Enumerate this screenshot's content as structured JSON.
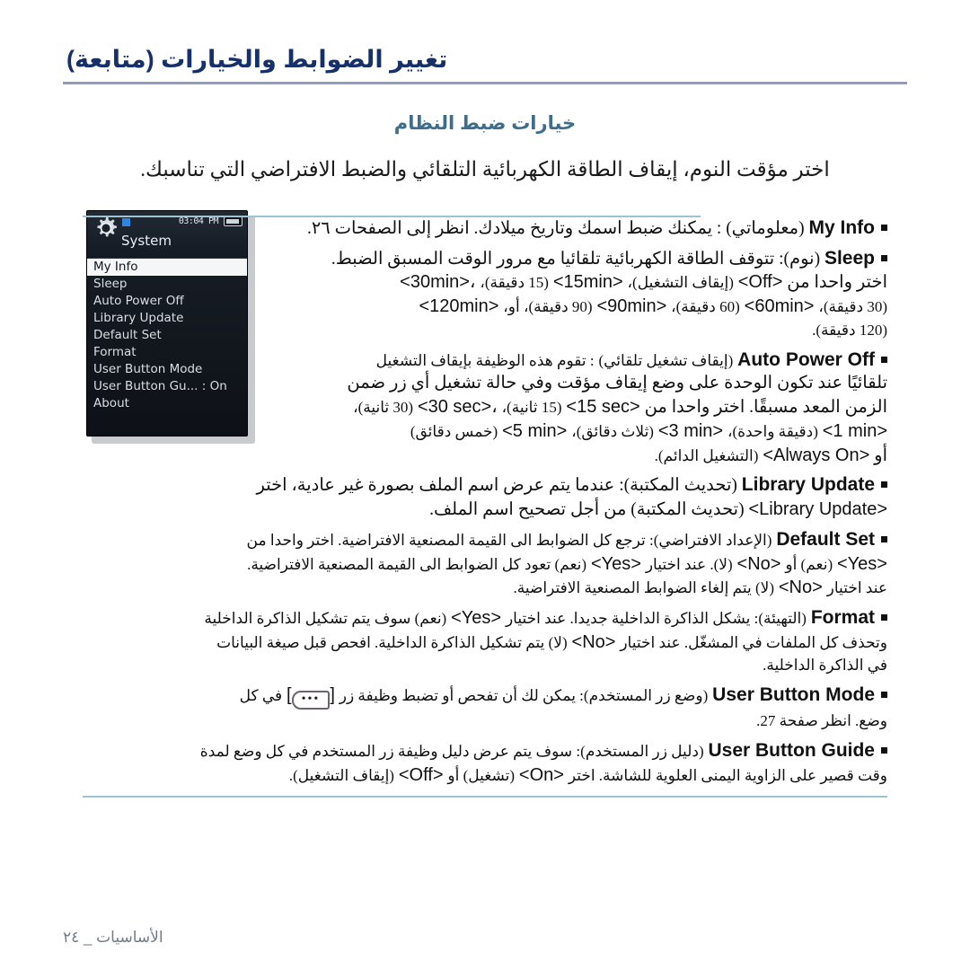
{
  "header": {
    "title": "تغيير الضوابط والخيارات (متابعة)"
  },
  "subtitle": "خيارات ضبط النظام",
  "intro": "اختر مؤقت النوم، إيقاف الطاقة الكهربائية التلقائي والضبط الافتراضي التي تناسبك.",
  "device": {
    "status_time": "03:04 PM",
    "battery_icon": "battery-icon",
    "gear_icon": "gear-icon",
    "menu_title": "System",
    "items": [
      {
        "label": "My Info",
        "selected": true
      },
      {
        "label": "Sleep",
        "selected": false
      },
      {
        "label": "Auto Power Off",
        "selected": false
      },
      {
        "label": "Library Update",
        "selected": false
      },
      {
        "label": "Default Set",
        "selected": false
      },
      {
        "label": "Format",
        "selected": false
      },
      {
        "label": "User Button Mode",
        "selected": false
      },
      {
        "label": "User Button Gu... : On",
        "selected": false
      },
      {
        "label": "About",
        "selected": false
      }
    ]
  },
  "bullets": {
    "my_info": {
      "term": "My Info",
      "gloss": "(معلوماتي)",
      "text": ": يمكنك ضبط اسمك وتاريخ ميلادك. انظر إلى الصفحات ٢٦."
    },
    "sleep": {
      "term": "Sleep",
      "gloss": "(نوم)",
      "l1": ": تتوقف الطاقة الكهربائية تلقائيا مع مرور الوقت المسبق الضبط.",
      "l2_a": "اختر واحدا من",
      "l2_off": "<Off>",
      "l2_off_g": "(إيقاف التشغيل)،",
      "l2_15": "<15min>",
      "l2_15_g": "(15 دقيقة)،",
      "l2_30": "<30min>،",
      "l3_30g": "(30 دقيقة)،",
      "l3_60": "<60min>",
      "l3_60g": "(60 دقيقة)،",
      "l3_90": "<90min>",
      "l3_90g": "(90 دقيقة)، أو،",
      "l3_120": "<120min>",
      "l4": "(120 دقيقة)."
    },
    "auto_power_off": {
      "term": "Auto Power Off",
      "gloss": "(إيقاف تشغيل تلقائي)",
      "l1": ": تقوم هذه الوظيفة بإيقاف التشغيل",
      "l2": "تلقائيًا عند تكون الوحدة على وضع إيقاف مؤقت وفي حالة تشغيل أي زر ضمن",
      "l3_a": "الزمن المعد مسبقًا. اختر واحدا من",
      "l3_15": "<15 sec>",
      "l3_15g": "(15 ثانية)،",
      "l3_30": "<30 sec>،",
      "l3_30g": "(30 ثانية)،",
      "l4_1": "<1 min>",
      "l4_1g": "(دقيقة واحدة)،",
      "l4_3": "<3 min>",
      "l4_3g": "(ثلاث دقائق)،",
      "l4_5": "<5 min>",
      "l4_5g": "(خمس دقائق)",
      "l5_a": "أو",
      "l5_always": "<Always On>",
      "l5_g": "(التشغيل الدائم)."
    },
    "library_update": {
      "term": "Library Update",
      "gloss": "(تحديث المكتبة)",
      "l1": ": عندما يتم عرض اسم الملف بصورة غير عادية، اختر",
      "l2_term": "<Library Update>",
      "l2_g": "(تحديث المكتبة) من أجل تصحيح اسم الملف."
    },
    "default_set": {
      "term": "Default Set",
      "gloss": "(الإعداد الافتراضي)",
      "l1": ": ترجع كل الضوابط الى القيمة المصنعية الافتراضية. اختر واحدا من",
      "l2_yes": "<Yes>",
      "l2_yesg": "(نعم) أو",
      "l2_no": "<No>",
      "l2_nog": "(لا). عند اختيار",
      "l2_yes2": "<Yes>",
      "l2_yes2g": "(نعم) تعود كل الضوابط الى القيمة المصنعية الافتراضية.",
      "l3_a": "عند اختيار",
      "l3_no": "<No>",
      "l3_g": "(لا) يتم إلغاء الضوابط المصنعية الافتراضية."
    },
    "format": {
      "term": "Format",
      "gloss": "(التهيئة)",
      "l1_a": ": يشكل الذاكرة الداخلية جديدا. عند اختيار",
      "l1_yes": "<Yes>",
      "l1_yesg": "(نعم) سوف يتم تشكيل الذاكرة الداخلية",
      "l2_a": "وتحذف كل الملفات في المشغّل. عند اختيار",
      "l2_no": "<No>",
      "l2_g": "(لا) يتم تشكيل الذاكرة الداخلية. افحص قبل صيغة البيانات",
      "l3": "في الذاكرة الداخلية."
    },
    "user_button_mode": {
      "term": "User Button Mode",
      "gloss": "(وضع زر المستخدم)",
      "l1_a": ": يمكن لك أن تفحص أو تضبط وظيفة زر",
      "button_icon": "user-button-icon",
      "button_dots": "•••",
      "l1_b": "في كل",
      "l2": "وضع. انظر صفحة 27."
    },
    "user_button_guide": {
      "term": "User Button Guide",
      "gloss": "(دليل زر المستخدم)",
      "l1": ": سوف يتم عرض دليل وظيفة زر المستخدم في كل وضع لمدة",
      "l2_a": "وقت قصير على الزاوية اليمنى العلوية للشاشة.  اختر",
      "l2_on": "<On>",
      "l2_ong": "(تشغيل) أو",
      "l2_off": "<Off>",
      "l2_offg": "(إيقاف التشغيل)."
    }
  },
  "footer": {
    "text": "الأساسيات _ ٢٤"
  },
  "colors": {
    "header": "#15306b",
    "header_rule": "#8e9dbc",
    "subtitle": "#3f6e8c",
    "section_rule": "#9ec4d4",
    "footer": "#707d8c",
    "device_accent": "#2e86e0"
  }
}
